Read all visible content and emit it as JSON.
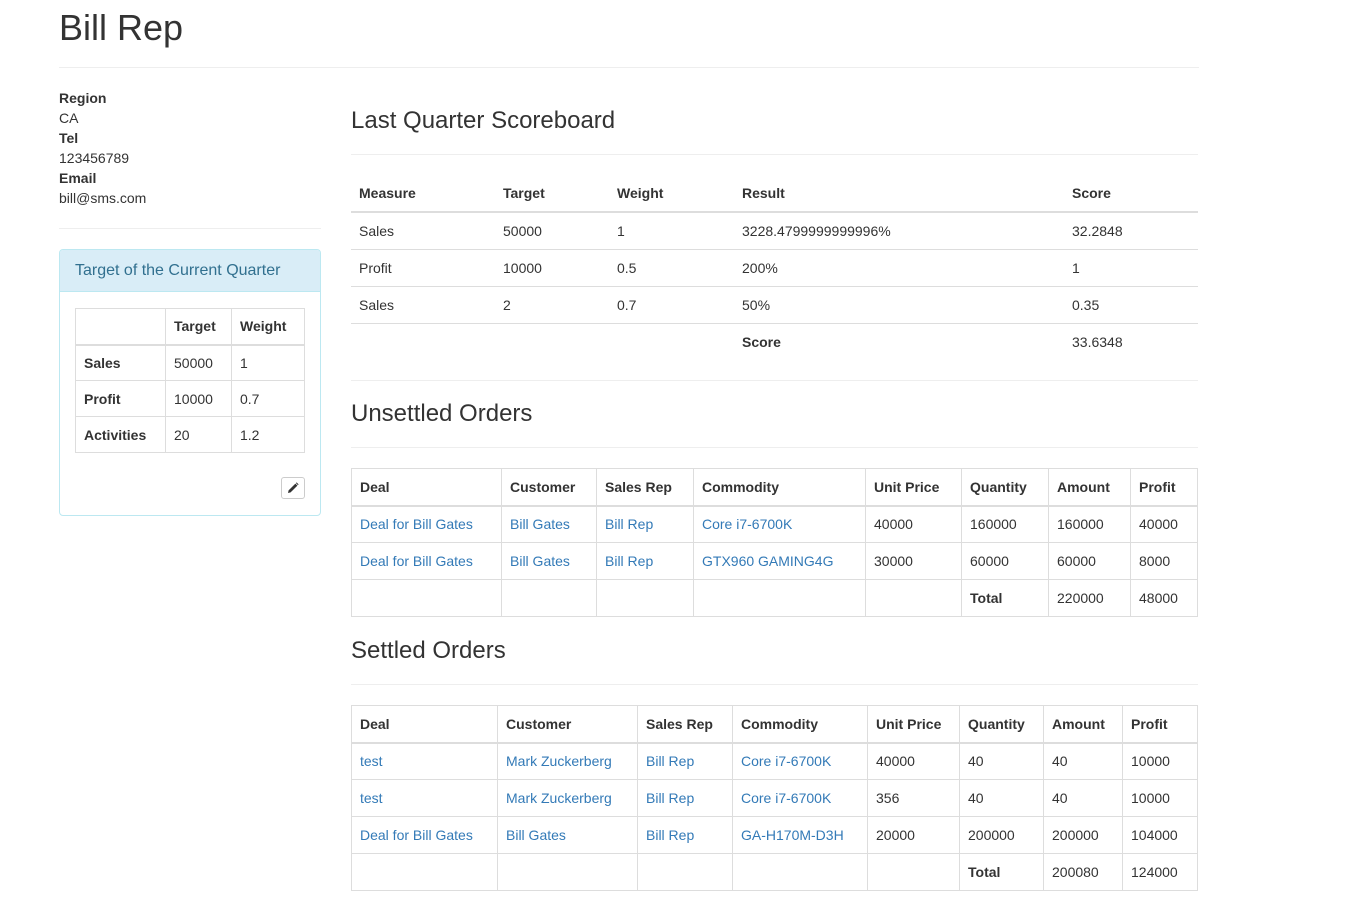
{
  "page_title": "Bill Rep",
  "profile": {
    "region_label": "Region",
    "region_value": "CA",
    "tel_label": "Tel",
    "tel_value": "123456789",
    "email_label": "Email",
    "email_value": "bill@sms.com"
  },
  "target_panel": {
    "title": "Target of the Current Quarter",
    "headers": [
      "",
      "Target",
      "Weight"
    ],
    "rows": [
      {
        "measure": "Sales",
        "target": "50000",
        "weight": "1"
      },
      {
        "measure": "Profit",
        "target": "10000",
        "weight": "0.7"
      },
      {
        "measure": "Activities",
        "target": "20",
        "weight": "1.2"
      }
    ],
    "edit_icon": "pencil-icon"
  },
  "scoreboard": {
    "title": "Last Quarter Scoreboard",
    "headers": [
      "Measure",
      "Target",
      "Weight",
      "Result",
      "Score"
    ],
    "rows": [
      {
        "measure": "Sales",
        "target": "50000",
        "weight": "1",
        "result": "3228.4799999999996%",
        "score": "32.2848"
      },
      {
        "measure": "Profit",
        "target": "10000",
        "weight": "0.5",
        "result": "200%",
        "score": "1"
      },
      {
        "measure": "Sales",
        "target": "2",
        "weight": "0.7",
        "result": "50%",
        "score": "0.35"
      }
    ],
    "total_label": "Score",
    "total_value": "33.6348"
  },
  "unsettled": {
    "title": "Unsettled Orders",
    "headers": [
      "Deal",
      "Customer",
      "Sales Rep",
      "Commodity",
      "Unit Price",
      "Quantity",
      "Amount",
      "Profit"
    ],
    "rows": [
      {
        "deal": "Deal for Bill Gates",
        "customer": "Bill Gates",
        "rep": "Bill Rep",
        "commodity": "Core i7-6700K",
        "unit_price": "40000",
        "quantity": "160000",
        "amount": "160000",
        "profit": "40000"
      },
      {
        "deal": "Deal for Bill Gates",
        "customer": "Bill Gates",
        "rep": "Bill Rep",
        "commodity": "GTX960 GAMING4G",
        "unit_price": "30000",
        "quantity": "60000",
        "amount": "60000",
        "profit": "8000"
      }
    ],
    "total_label": "Total",
    "total_amount": "220000",
    "total_profit": "48000"
  },
  "settled": {
    "title": "Settled Orders",
    "headers": [
      "Deal",
      "Customer",
      "Sales Rep",
      "Commodity",
      "Unit Price",
      "Quantity",
      "Amount",
      "Profit"
    ],
    "rows": [
      {
        "deal": "test",
        "customer": "Mark Zuckerberg",
        "rep": "Bill Rep",
        "commodity": "Core i7-6700K",
        "unit_price": "40000",
        "quantity": "40",
        "amount": "40",
        "profit": "10000"
      },
      {
        "deal": "test",
        "customer": "Mark Zuckerberg",
        "rep": "Bill Rep",
        "commodity": "Core i7-6700K",
        "unit_price": "356",
        "quantity": "40",
        "amount": "40",
        "profit": "10000"
      },
      {
        "deal": "Deal for Bill Gates",
        "customer": "Bill Gates",
        "rep": "Bill Rep",
        "commodity": "GA-H170M-D3H",
        "unit_price": "20000",
        "quantity": "200000",
        "amount": "200000",
        "profit": "104000"
      }
    ],
    "total_label": "Total",
    "total_amount": "200080",
    "total_profit": "124000"
  },
  "colors": {
    "link": "#337ab7",
    "panel_heading_bg": "#d9edf7",
    "panel_border": "#bce8f1",
    "panel_title": "#31708f"
  }
}
